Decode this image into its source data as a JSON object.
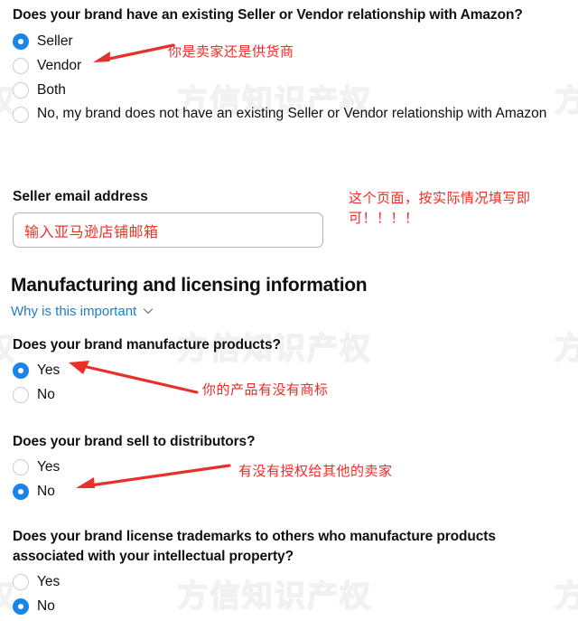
{
  "watermark": {
    "text": "方信知识产权",
    "partial_left": "权",
    "partial_right": "方"
  },
  "question_seller_relationship": {
    "title": "Does your brand have an existing Seller or Vendor relationship with Amazon?",
    "options": [
      {
        "label": "Seller",
        "checked": true
      },
      {
        "label": "Vendor",
        "checked": false
      },
      {
        "label": "Both",
        "checked": false
      },
      {
        "label": "No, my brand does not have an existing Seller or Vendor relationship with Amazon",
        "checked": false
      }
    ]
  },
  "seller_email": {
    "label": "Seller email address",
    "value": "输入亚马逊店铺邮箱",
    "placeholder": ""
  },
  "manufacturing_section": {
    "heading": "Manufacturing and licensing information",
    "why_link": "Why is this important",
    "chevron_icon": "chevron-down-icon"
  },
  "question_manufacture": {
    "title": "Does your brand manufacture products?",
    "options": [
      {
        "label": "Yes",
        "checked": true
      },
      {
        "label": "No",
        "checked": false
      }
    ]
  },
  "question_distributors": {
    "title": "Does your brand sell to distributors?",
    "options": [
      {
        "label": "Yes",
        "checked": false
      },
      {
        "label": "No",
        "checked": true
      }
    ]
  },
  "question_license_trademarks": {
    "title": "Does your brand license trademarks to others who manufacture products associated with your intellectual property?",
    "options": [
      {
        "label": "Yes",
        "checked": false
      },
      {
        "label": "No",
        "checked": true
      }
    ]
  },
  "annotations": [
    {
      "name": "annotation-seller-or-vendor",
      "text": "你是卖家还是供货商"
    },
    {
      "name": "annotation-fill-as-actual",
      "text": "这个页面，按实际情况填写即\n可！！！！"
    },
    {
      "name": "annotation-product-trademark",
      "text": "你的产品有没有商标"
    },
    {
      "name": "annotation-authorized-sellers",
      "text": "有没有授权给其他的卖家"
    }
  ],
  "colors": {
    "radio_selected": "#1a85e8",
    "annotation_red": "#ef2b25",
    "link_blue": "#1f7ec2",
    "text": "#0f1111"
  }
}
